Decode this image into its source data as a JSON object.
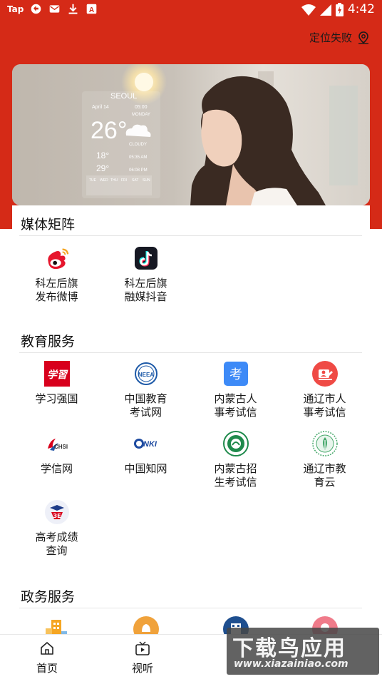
{
  "status_bar": {
    "tap_label": "Tap",
    "time": "4:42"
  },
  "header": {
    "location_text": "定位失败"
  },
  "banner": {
    "city": "SEOUL",
    "date": "April 14",
    "temperature": "26°",
    "weather": "CLOUDY",
    "weekday": "MONDAY",
    "low": "18°",
    "high": "29°",
    "time1": "05:00",
    "time2": "05:35 AM",
    "time3": "06:08 PM",
    "days": [
      "TUE",
      "WED",
      "THU",
      "FRI",
      "SAT",
      "SUN"
    ]
  },
  "sections": {
    "media": {
      "title": "媒体矩阵",
      "items": [
        {
          "label": "科左后旗发布微博",
          "icon": "weibo-icon"
        },
        {
          "label": "科左后旗融媒抖音",
          "icon": "douyin-icon"
        }
      ]
    },
    "education": {
      "title": "教育服务",
      "items": [
        {
          "label": "学习强国",
          "icon": "xuexi-icon"
        },
        {
          "label": "中国教育考试网",
          "icon": "neea-icon"
        },
        {
          "label": "内蒙古人事考试信",
          "icon": "kao-icon"
        },
        {
          "label": "通辽市人事考试信",
          "icon": "tongliao-exam-icon"
        },
        {
          "label": "学信网",
          "icon": "chsi-icon"
        },
        {
          "label": "中国知网",
          "icon": "cnki-icon"
        },
        {
          "label": "内蒙古招生考试信",
          "icon": "nm-zhaosheng-icon"
        },
        {
          "label": "通辽市教育云",
          "icon": "tongliao-edu-icon"
        },
        {
          "label": "高考成绩查询",
          "icon": "gaokao-icon"
        }
      ]
    },
    "government": {
      "title": "政务服务"
    }
  },
  "bottom_nav": {
    "items": [
      {
        "label": "首页",
        "icon": "home-icon"
      },
      {
        "label": "视听",
        "icon": "video-icon"
      }
    ]
  },
  "watermark": {
    "main": "下载鸟应用",
    "sub": "www.xiazainiao.com"
  }
}
